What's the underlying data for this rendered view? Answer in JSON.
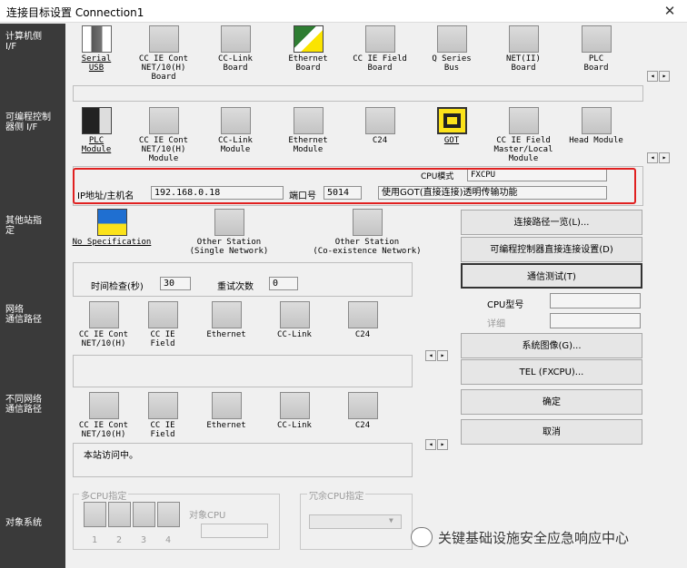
{
  "window": {
    "title": "连接目标设置 Connection1",
    "close_glyph": "✕"
  },
  "sidebar": {
    "pc_side": "计算机侧\nI/F",
    "plc_side": "可编程控制\n器侧 I/F",
    "other_station": "其他站指\n定",
    "network_route": "网络\n通信路径",
    "diff_network_route": "不同网络\n通信路径",
    "target_system": "对象系统"
  },
  "pc_if": [
    {
      "label": "Serial\nUSB",
      "icon": "serial-usb-icon"
    },
    {
      "label": "CC IE Cont\nNET/10(H)\nBoard",
      "icon": "board-icon"
    },
    {
      "label": "CC-Link\nBoard",
      "icon": "board-icon"
    },
    {
      "label": "Ethernet\nBoard",
      "icon": "ethernet-icon"
    },
    {
      "label": "CC IE Field\nBoard",
      "icon": "board-icon"
    },
    {
      "label": "Q Series\nBus",
      "icon": "board-icon"
    },
    {
      "label": "NET(II)\nBoard",
      "icon": "board-icon"
    },
    {
      "label": "PLC\nBoard",
      "icon": "board-icon"
    }
  ],
  "plc_if": [
    {
      "label": "PLC\nModule",
      "icon": "plc-module-icon"
    },
    {
      "label": "CC IE Cont\nNET/10(H)\nModule",
      "icon": "board-icon"
    },
    {
      "label": "CC-Link\nModule",
      "icon": "board-icon"
    },
    {
      "label": "Ethernet\nModule",
      "icon": "board-icon"
    },
    {
      "label": "C24",
      "icon": "board-icon"
    },
    {
      "label": "GOT",
      "icon": "got-icon"
    },
    {
      "label": "CC IE Field\nMaster/Local\nModule",
      "icon": "board-icon"
    },
    {
      "label": "Head Module",
      "icon": "board-icon"
    }
  ],
  "connection": {
    "cpu_mode_label": "CPU模式",
    "cpu_mode_value": "FXCPU",
    "ip_label": "IP地址/主机名",
    "ip_value": "192.168.0.18",
    "port_label": "端口号",
    "port_value": "5014",
    "got_note": "使用GOT(直接连接)透明传输功能"
  },
  "other_station": [
    {
      "label": "No Specification",
      "icon": "no-spec-icon"
    },
    {
      "label": "Other Station\n(Single Network)",
      "icon": "board-icon"
    },
    {
      "label": "Other Station\n(Co-existence Network)",
      "icon": "board-icon"
    }
  ],
  "timing": {
    "check_label": "时间检查(秒)",
    "check_value": "30",
    "retry_label": "重试次数",
    "retry_value": "0"
  },
  "network_route": [
    {
      "label": "CC IE Cont\nNET/10(H)"
    },
    {
      "label": "CC IE\nField"
    },
    {
      "label": "Ethernet"
    },
    {
      "label": "CC-Link"
    },
    {
      "label": "C24"
    }
  ],
  "diff_network": [
    {
      "label": "CC IE Cont\nNET/10(H)"
    },
    {
      "label": "CC IE\nField"
    },
    {
      "label": "Ethernet"
    },
    {
      "label": "CC-Link"
    },
    {
      "label": "C24"
    }
  ],
  "diff_network_status": "本站访问中。",
  "buttons": {
    "route_list": "连接路径一览(L)...",
    "plc_direct": "可编程控制器直接连接设置(D)",
    "comm_test": "通信测试(T)",
    "system_image": "系统图像(G)...",
    "tel": "TEL (FXCPU)...",
    "ok": "确定",
    "cancel": "取消"
  },
  "cpu_info": {
    "cpu_type_label": "CPU型号",
    "detail_label": "详细"
  },
  "multi_cpu": {
    "title": "多CPU指定",
    "numbers": [
      "1",
      "2",
      "3",
      "4"
    ],
    "target_cpu_label": "对象CPU"
  },
  "redundant_cpu": {
    "title": "冗余CPU指定"
  },
  "watermark": "关键基础设施安全应急响应中心"
}
